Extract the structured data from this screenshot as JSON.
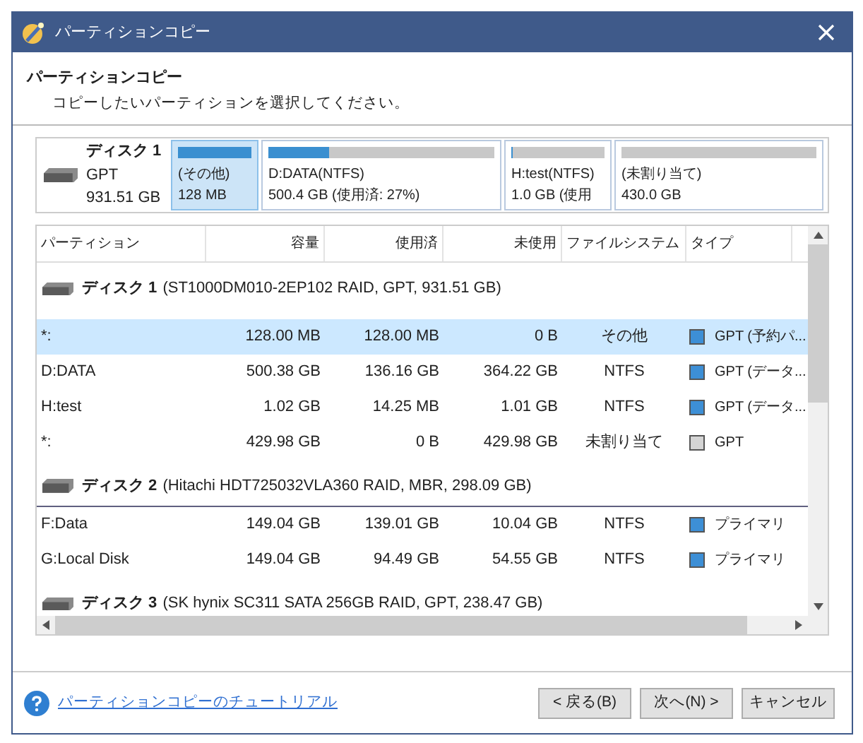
{
  "window": {
    "title": "パーティションコピー"
  },
  "header": {
    "title": "パーティションコピー",
    "subtitle": "コピーしたいパーティションを選択してください。"
  },
  "disk_map": {
    "disk": {
      "name": "ディスク 1",
      "style": "GPT",
      "size": "931.51 GB"
    },
    "partitions": [
      {
        "label": "(その他)",
        "size": "128 MB",
        "level": 1,
        "selected": true
      },
      {
        "label": "D:DATA(NTFS)",
        "size": "500.4 GB (使用済: 27%)",
        "level": 0.27,
        "selected": false
      },
      {
        "label": "H:test(NTFS)",
        "size": "1.0 GB (使用",
        "level": 0.02,
        "selected": false
      },
      {
        "label": "(未割り当て)",
        "size": "430.0 GB",
        "level": 0,
        "selected": false
      }
    ]
  },
  "table": {
    "columns": [
      "パーティション",
      "容量",
      "使用済",
      "未使用",
      "ファイルシステム",
      "タイプ"
    ],
    "disks": [
      {
        "name": "ディスク 1",
        "detail": "(ST1000DM010-2EP102 RAID, GPT, 931.51 GB)",
        "children": [
          {
            "partition": "*:",
            "capacity": "128.00 MB",
            "used": "128.00 MB",
            "unused": "0 B",
            "fs": "その他",
            "type": "GPT (予約パ...",
            "color": "#3d8fd6",
            "selected": true
          },
          {
            "partition": "D:DATA",
            "capacity": "500.38 GB",
            "used": "136.16 GB",
            "unused": "364.22 GB",
            "fs": "NTFS",
            "type": "GPT (データ...",
            "color": "#3d8fd6",
            "selected": false
          },
          {
            "partition": "H:test",
            "capacity": "1.02 GB",
            "used": "14.25 MB",
            "unused": "1.01 GB",
            "fs": "NTFS",
            "type": "GPT (データ...",
            "color": "#3d8fd6",
            "selected": false
          },
          {
            "partition": "*:",
            "capacity": "429.98 GB",
            "used": "0 B",
            "unused": "429.98 GB",
            "fs": "未割り当て",
            "type": "GPT",
            "color": "#d4d4d4",
            "selected": false
          }
        ]
      },
      {
        "name": "ディスク 2",
        "detail": "(Hitachi HDT725032VLA360 RAID, MBR, 298.09 GB)",
        "children": [
          {
            "partition": "F:Data",
            "capacity": "149.04 GB",
            "used": "139.01 GB",
            "unused": "10.04 GB",
            "fs": "NTFS",
            "type": "プライマリ",
            "color": "#3d8fd6",
            "selected": false
          },
          {
            "partition": "G:Local Disk",
            "capacity": "149.04 GB",
            "used": "94.49 GB",
            "unused": "54.55 GB",
            "fs": "NTFS",
            "type": "プライマリ",
            "color": "#3d8fd6",
            "selected": false
          }
        ]
      },
      {
        "name": "ディスク 3",
        "detail": "(SK hynix SC311 SATA 256GB RAID, GPT, 238.47 GB)"
      }
    ]
  },
  "footer": {
    "help_link": "パーティションコピーのチュートリアル",
    "buttons": [
      "< 戻る(B)",
      "次へ(N) >",
      "キャンセル"
    ]
  }
}
